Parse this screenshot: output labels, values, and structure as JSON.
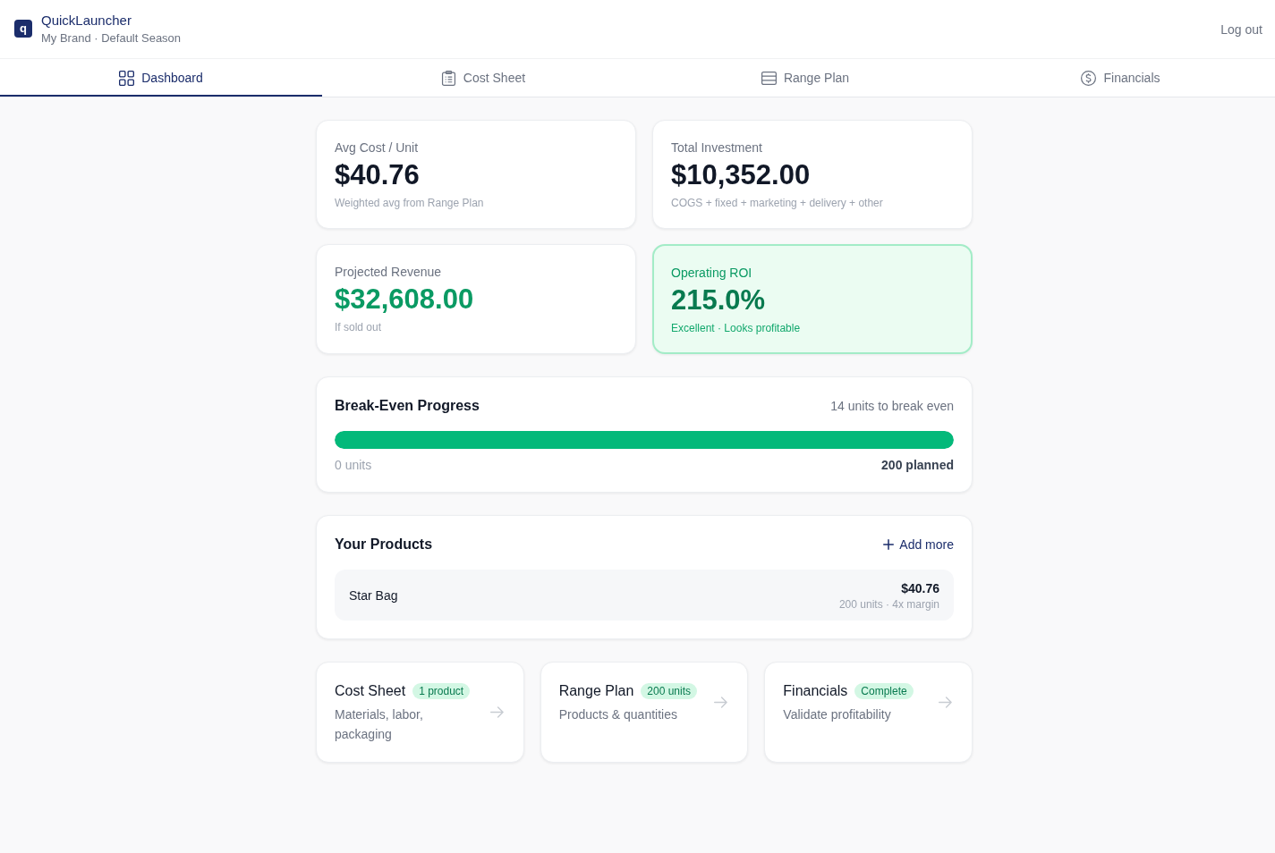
{
  "header": {
    "logo_letter": "q",
    "title": "QuickLauncher",
    "subtitle": "My Brand · Default Season",
    "logout": "Log out"
  },
  "tabs": [
    {
      "label": "Dashboard",
      "selected": true
    },
    {
      "label": "Cost Sheet",
      "selected": false
    },
    {
      "label": "Range Plan",
      "selected": false
    },
    {
      "label": "Financials",
      "selected": false
    }
  ],
  "stats": [
    {
      "label": "Avg Cost / Unit",
      "value": "$40.76",
      "note": "Weighted avg from Range Plan",
      "kind": "plain"
    },
    {
      "label": "Total Investment",
      "value": "$10,352.00",
      "note": "COGS + fixed + marketing + delivery + other",
      "kind": "plain"
    },
    {
      "label": "Projected Revenue",
      "value": "$32,608.00",
      "note": "If sold out",
      "kind": "positive"
    },
    {
      "label": "Operating ROI",
      "value": "215.0%",
      "note": "Excellent · Looks profitable",
      "kind": "highlight"
    }
  ],
  "break_even": {
    "title": "Break-Even Progress",
    "summary": "14 units to break even",
    "level": 1,
    "start_label": "0 units",
    "end_label": "200 planned"
  },
  "products": {
    "title": "Your Products",
    "add_label": "Add more",
    "items": [
      {
        "name": "Star Bag",
        "price": "$40.76",
        "detail": "200 units · 4x margin"
      }
    ]
  },
  "sections": [
    {
      "title": "Cost Sheet",
      "badge": "1 product",
      "description": "Materials, labor, packaging"
    },
    {
      "title": "Range Plan",
      "badge": "200 units",
      "description": "Products & quantities"
    },
    {
      "title": "Financials",
      "badge": "Complete",
      "description": "Validate profitability"
    }
  ]
}
